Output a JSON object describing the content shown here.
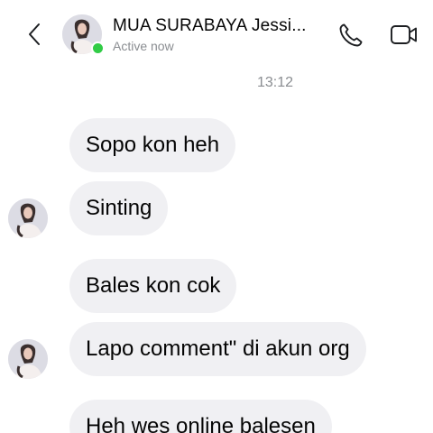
{
  "header": {
    "back_icon": "chevron-left-icon",
    "contact_name": "MUA SURABAYA Jessi...",
    "status": "Active now",
    "call_icon": "phone-icon",
    "video_icon": "video-camera-icon",
    "online_color": "#31cc46"
  },
  "thread": {
    "timestamp": "13:12",
    "messages": [
      {
        "text": "Sopo kon heh"
      },
      {
        "text": "Sinting"
      },
      {
        "text": "Bales kon cok"
      },
      {
        "text": "Lapo comment\" di akun org"
      },
      {
        "text": "Heh wes online balesen"
      }
    ]
  },
  "colors": {
    "bubble_bg": "#f0f0f3",
    "meta_text": "#8a8d91",
    "text": "#050505"
  }
}
